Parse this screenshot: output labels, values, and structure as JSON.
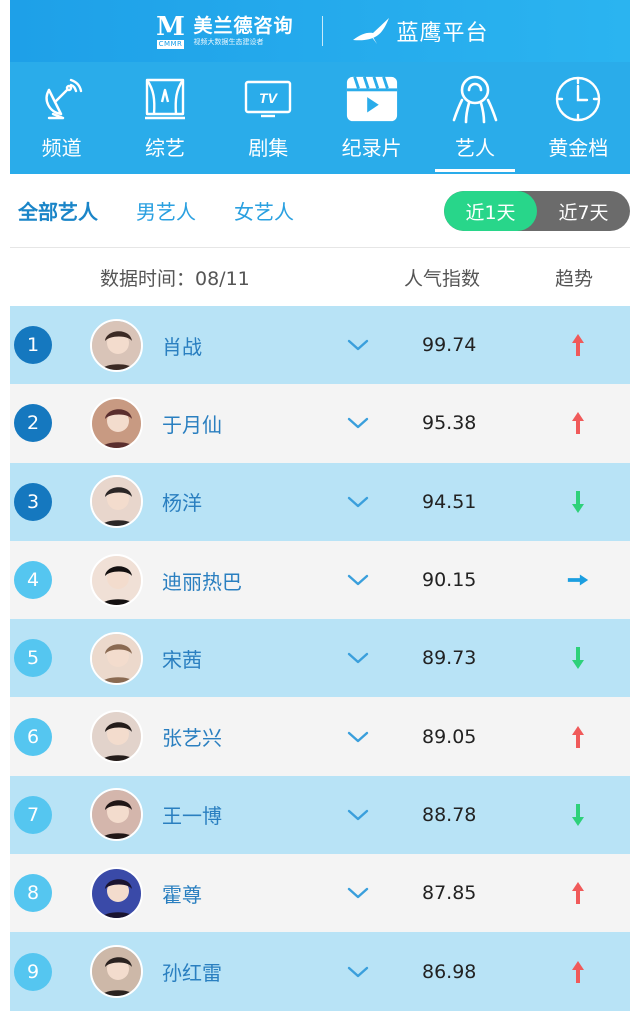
{
  "header": {
    "brand_name": "美兰德咨询",
    "brand_abbr": "CMMR",
    "brand_slogan": "视频大数据生态建设者",
    "platform_name": "蓝鹰平台"
  },
  "categories": [
    {
      "label": "频道",
      "icon": "satellite-dish-icon"
    },
    {
      "label": "综艺",
      "icon": "stage-curtain-icon"
    },
    {
      "label": "剧集",
      "icon": "tv-icon"
    },
    {
      "label": "纪录片",
      "icon": "film-clapper-icon"
    },
    {
      "label": "艺人",
      "icon": "artist-icon",
      "active": true
    },
    {
      "label": "黄金档",
      "icon": "clock-icon"
    }
  ],
  "filters": {
    "tabs": [
      "全部艺人",
      "男艺人",
      "女艺人"
    ],
    "active_tab": "全部艺人",
    "range_options": [
      "近1天",
      "近7天"
    ],
    "active_range": "近1天"
  },
  "columns": {
    "date_label": "数据时间：08/11",
    "popularity": "人气指数",
    "trend": "趋势"
  },
  "ranking": [
    {
      "rank": "1",
      "name": "肖战",
      "score": "99.74",
      "trend": "up"
    },
    {
      "rank": "2",
      "name": "于月仙",
      "score": "95.38",
      "trend": "up"
    },
    {
      "rank": "3",
      "name": "杨洋",
      "score": "94.51",
      "trend": "down"
    },
    {
      "rank": "4",
      "name": "迪丽热巴",
      "score": "90.15",
      "trend": "flat"
    },
    {
      "rank": "5",
      "name": "宋茜",
      "score": "89.73",
      "trend": "down"
    },
    {
      "rank": "6",
      "name": "张艺兴",
      "score": "89.05",
      "trend": "up"
    },
    {
      "rank": "7",
      "name": "王一博",
      "score": "88.78",
      "trend": "down"
    },
    {
      "rank": "8",
      "name": "霍尊",
      "score": "87.85",
      "trend": "up"
    },
    {
      "rank": "9",
      "name": "孙红雷",
      "score": "86.98",
      "trend": "up"
    }
  ],
  "colors": {
    "header_bg": "#1ea0e8",
    "nav_bg": "#2aacea",
    "row_highlight": "#b8e3f6",
    "row_plain": "#f4f4f4",
    "rank_top": "#1578bf",
    "rank_rest": "#55c6f0",
    "trend_up": "#f05a5a",
    "trend_down": "#2ed17a",
    "trend_flat": "#1b9ee0",
    "toggle_active": "#28d68a"
  }
}
